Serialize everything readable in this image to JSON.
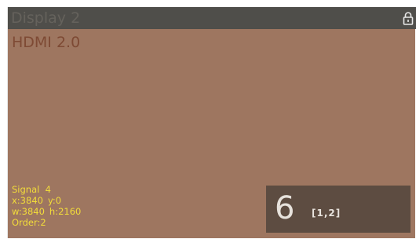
{
  "display": {
    "name": "Display 2",
    "port": "HDMI 2.0",
    "lock_icon": "lock-icon",
    "background_color": "#9e7660",
    "title_bar_color": "#4f4e4a"
  },
  "info": {
    "signal": "Signal  4",
    "x": "x:3840",
    "y": "y:0",
    "w": "w:3840",
    "h": "h:2160",
    "order": "Order:2",
    "text_color": "#f2dc3a"
  },
  "identifier": {
    "number": "6",
    "grid_position": "[1,2]"
  }
}
